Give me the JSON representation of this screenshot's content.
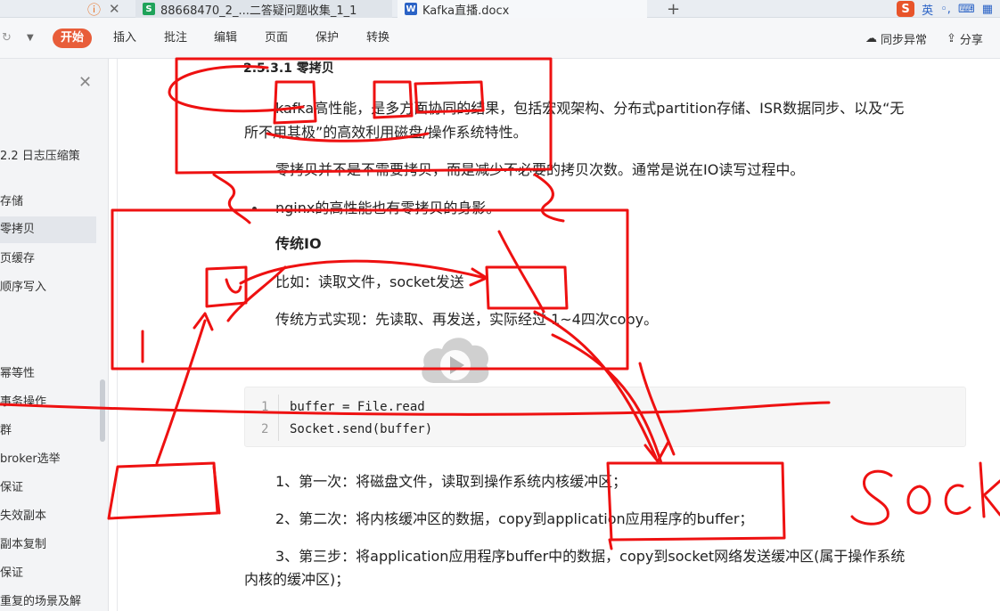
{
  "tabbar": {
    "tabs": [
      {
        "label": "88668470_2_...二答疑问题收集_1_1",
        "badge": "S",
        "badge_color": "#1fa35a"
      },
      {
        "label": "Kafka直播.docx",
        "badge": "W",
        "badge_color": "#2b63c6"
      }
    ],
    "add_tab": "+",
    "ime_logo": "S",
    "ime_lang": "英"
  },
  "menubar": {
    "start": "开始",
    "items": [
      "插入",
      "批注",
      "编辑",
      "页面",
      "保护",
      "转换"
    ],
    "sync": "同步异常",
    "share": "分享"
  },
  "sidebar": {
    "items": [
      {
        "label": "2.2 日志压缩策",
        "selected": false
      },
      {
        "label": "存储",
        "selected": false
      },
      {
        "label": "零拷贝",
        "selected": true
      },
      {
        "label": "页缓存",
        "selected": false
      },
      {
        "label": "顺序写入",
        "selected": false
      },
      {
        "label": "幂等性",
        "selected": false
      },
      {
        "label": "事务操作",
        "selected": false
      },
      {
        "label": "群",
        "selected": false
      },
      {
        "label": "broker选举",
        "selected": false
      },
      {
        "label": "保证",
        "selected": false
      },
      {
        "label": "失效副本",
        "selected": false
      },
      {
        "label": "副本复制",
        "selected": false
      },
      {
        "label": "保证",
        "selected": false
      },
      {
        "label": "重复的场景及解",
        "selected": false
      }
    ]
  },
  "doc": {
    "heading": "2.5.3.1 零拷贝",
    "para1_line1": "kafka高性能，是多方面协同的结果，包括宏观架构、分布式partition存储、ISR数据同步、以及“无",
    "para1_line2": "所不用其极”的高效利用磁盘/操作系统特性。",
    "para2": "零拷贝并不是不需要拷贝，而是减少不必要的拷贝次数。通常是说在IO读写过程中。",
    "bullet": "nginx的高性能也有零拷贝的身影。",
    "sub_heading": "传统IO",
    "example": "比如：读取文件，socket发送",
    "impl": "传统方式实现：先读取、再发送，实际经过 1~4四次copy。",
    "code": [
      {
        "num": "1",
        "text": "buffer = File.read"
      },
      {
        "num": "2",
        "text": "Socket.send(buffer)"
      }
    ],
    "step1": "1、第一次：将磁盘文件，读取到操作系统内核缓冲区；",
    "step2": "2、第二次：将内核缓冲区的数据，copy到application应用程序的buffer；",
    "step3_line1": "3、第三步：将application应用程序buffer中的数据，copy到socket网络发送缓冲区(属于操作系统",
    "step3_line2": "内核的缓冲区)；"
  },
  "annotation": {
    "handwriting": "Socke",
    "ink_color": "#ee1111"
  }
}
